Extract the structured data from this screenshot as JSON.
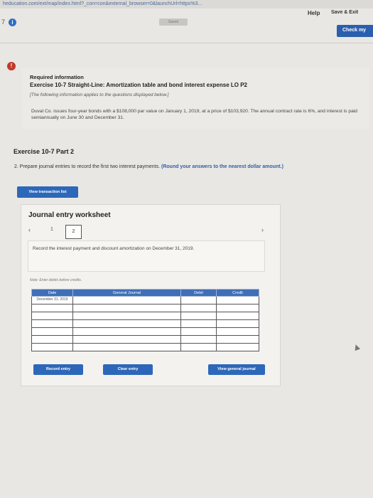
{
  "browser": {
    "url": "heducation.com/ext/map/index.html?_con=con&external_browser=0&launchUrl=https%3..."
  },
  "header": {
    "nav_number": "7",
    "info_icon": "info-icon",
    "saved_label": "Saved",
    "help_label": "Help",
    "save_exit_label": "Save & Exit",
    "check_label": "Check my"
  },
  "required_info": {
    "title": "Required information",
    "exercise_title": "Exercise 10-7 Straight-Line: Amortization table and bond interest expense LO P2",
    "note": "[The following information applies to the questions displayed below.]",
    "body": "Duval Co. issues four-year bonds with a $108,000 par value on January 1, 2019, at a price of $103,920. The annual contract rate is 6%, and interest is paid semiannually on June 30 and December 31."
  },
  "part": {
    "title": "Exercise 10-7 Part 2",
    "instruction_main": "2. Prepare journal entries to record the first two interest payments.",
    "instruction_emphasis": "(Round your answers to the nearest dollar amount.)"
  },
  "buttons": {
    "view_transaction_list": "View transaction list",
    "record_entry": "Record entry",
    "clear_entry": "Clear entry",
    "view_general_journal": "View general journal"
  },
  "worksheet": {
    "title": "Journal entry worksheet",
    "step1": "1",
    "step2": "2",
    "instruction": "Record the interest payment and discount amortization on December 31, 2019.",
    "note": "Note: Enter debits before credits.",
    "columns": [
      "Date",
      "General Journal",
      "Debit",
      "Credit"
    ],
    "rows": [
      {
        "date": "December 31, 2019",
        "account": "",
        "debit": "",
        "credit": ""
      },
      {
        "date": "",
        "account": "",
        "debit": "",
        "credit": ""
      },
      {
        "date": "",
        "account": "",
        "debit": "",
        "credit": ""
      },
      {
        "date": "",
        "account": "",
        "debit": "",
        "credit": ""
      },
      {
        "date": "",
        "account": "",
        "debit": "",
        "credit": ""
      },
      {
        "date": "",
        "account": "",
        "debit": "",
        "credit": ""
      },
      {
        "date": "",
        "account": "",
        "debit": "",
        "credit": ""
      }
    ]
  },
  "colors": {
    "accent_blue": "#2d67b9",
    "header_blue": "#3f6fb7",
    "alert_red": "#c0392b"
  }
}
